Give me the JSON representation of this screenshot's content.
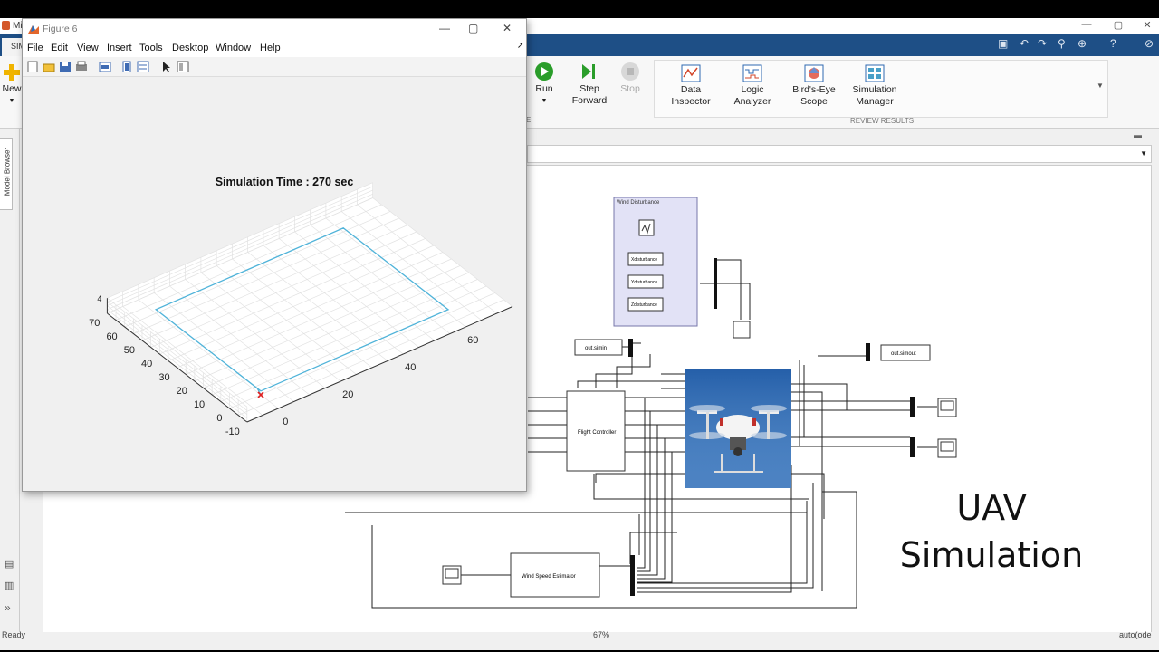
{
  "main_window": {
    "title_fragment": "Mi",
    "first_tab": "SIM",
    "new_label": "New",
    "model_browser_label": "Model Browser",
    "expand_chevron": "»"
  },
  "ribbon": {
    "simulate": {
      "run_label": "Run",
      "step_forward_label": "Step Forward",
      "stop_label": "Stop"
    },
    "review_results": {
      "section_label": "REVIEW RESULTS",
      "buttons": [
        {
          "label": "Data Inspector",
          "icon": "data-inspector-icon"
        },
        {
          "label": "Logic Analyzer",
          "icon": "logic-analyzer-icon"
        },
        {
          "label": "Bird's-Eye Scope",
          "icon": "birds-eye-scope-icon"
        },
        {
          "label": "Simulation Manager",
          "icon": "simulation-manager-icon"
        }
      ]
    }
  },
  "statusbar": {
    "left": "Ready",
    "zoom": "67%",
    "right": "auto(ode"
  },
  "figure": {
    "title": "Figure 6",
    "menu": [
      "File",
      "Edit",
      "View",
      "Insert",
      "Tools",
      "Desktop",
      "Window",
      "Help"
    ],
    "toolbar_icons": [
      "new-icon",
      "open-icon",
      "save-icon",
      "print-icon",
      "link-icon",
      "insert-colorbar-icon",
      "insert-legend-icon",
      "pointer-icon",
      "property-inspector-icon"
    ]
  },
  "chart_data": {
    "type": "line",
    "title": "Simulation Time : 270 sec",
    "projection": "3d",
    "xlabel": "",
    "ylabel": "",
    "zlabel": "",
    "x_ticks": [
      0,
      20,
      40,
      60
    ],
    "y_ticks": [
      -10,
      0,
      10,
      20,
      30,
      40,
      50,
      60,
      70
    ],
    "z_ticks": [
      4
    ],
    "xlim": [
      -10,
      75
    ],
    "ylim": [
      -10,
      70
    ],
    "zlim": [
      0,
      4
    ],
    "grid": true,
    "series": [
      {
        "color": "#4fb3d9",
        "x": [
          0,
          0,
          0,
          60,
          60,
          0,
          0
        ],
        "y": [
          0,
          2,
          60,
          60,
          0,
          0,
          2
        ],
        "z": [
          0,
          1,
          1,
          1,
          1,
          1,
          1
        ]
      }
    ],
    "marker": {
      "color": "#e02020",
      "x": 0,
      "y": 0,
      "z": 0
    }
  },
  "diagram": {
    "wind_subsystem_title": "Wind Disturbance",
    "wind_blocks": [
      "Xdisturbance",
      "Ydisturbance",
      "Zdisturbance"
    ],
    "to_workspace_in": "out.simin",
    "to_workspace_out": "out.simout",
    "flight_controller": "Flight Controller",
    "wind_estimator": "Wind Speed Estimator",
    "overlay_title": "UAV Simulation"
  }
}
